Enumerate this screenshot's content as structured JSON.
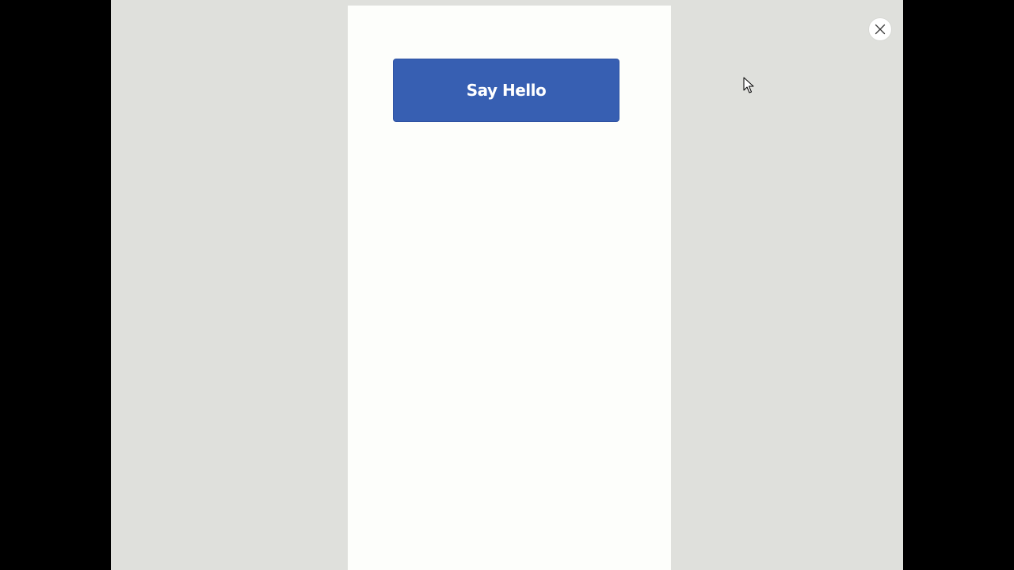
{
  "preview": {
    "primary_button": {
      "label": "Say Hello",
      "color": "#375fb2",
      "text_color": "#ffffff"
    },
    "close_button": {
      "icon": "close-icon"
    },
    "cursor": {
      "icon": "mouse-pointer-icon"
    },
    "colors": {
      "letterbox": "#000000",
      "backdrop": "#dfe0dc",
      "canvas": "#fdfefb"
    }
  }
}
